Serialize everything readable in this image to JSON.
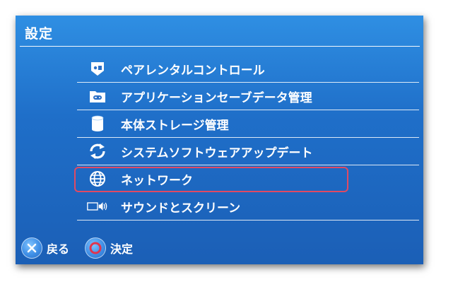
{
  "header": {
    "title": "設定"
  },
  "menu": {
    "items": [
      {
        "label": "ペアレンタルコントロール",
        "icon": "parental-control-icon"
      },
      {
        "label": "アプリケーションセーブデータ管理",
        "icon": "folder-gamepad-icon"
      },
      {
        "label": "本体ストレージ管理",
        "icon": "storage-icon"
      },
      {
        "label": "システムソフトウェアアップデート",
        "icon": "update-icon"
      },
      {
        "label": "ネットワーク",
        "icon": "globe-icon",
        "selected": true
      },
      {
        "label": "サウンドとスクリーン",
        "icon": "sound-screen-icon"
      }
    ]
  },
  "footer": {
    "back_label": "戻る",
    "confirm_label": "決定"
  },
  "colors": {
    "selection_border": "#e04a63",
    "background_top": "#2f8fe3",
    "background_bottom": "#1b5fb6"
  }
}
